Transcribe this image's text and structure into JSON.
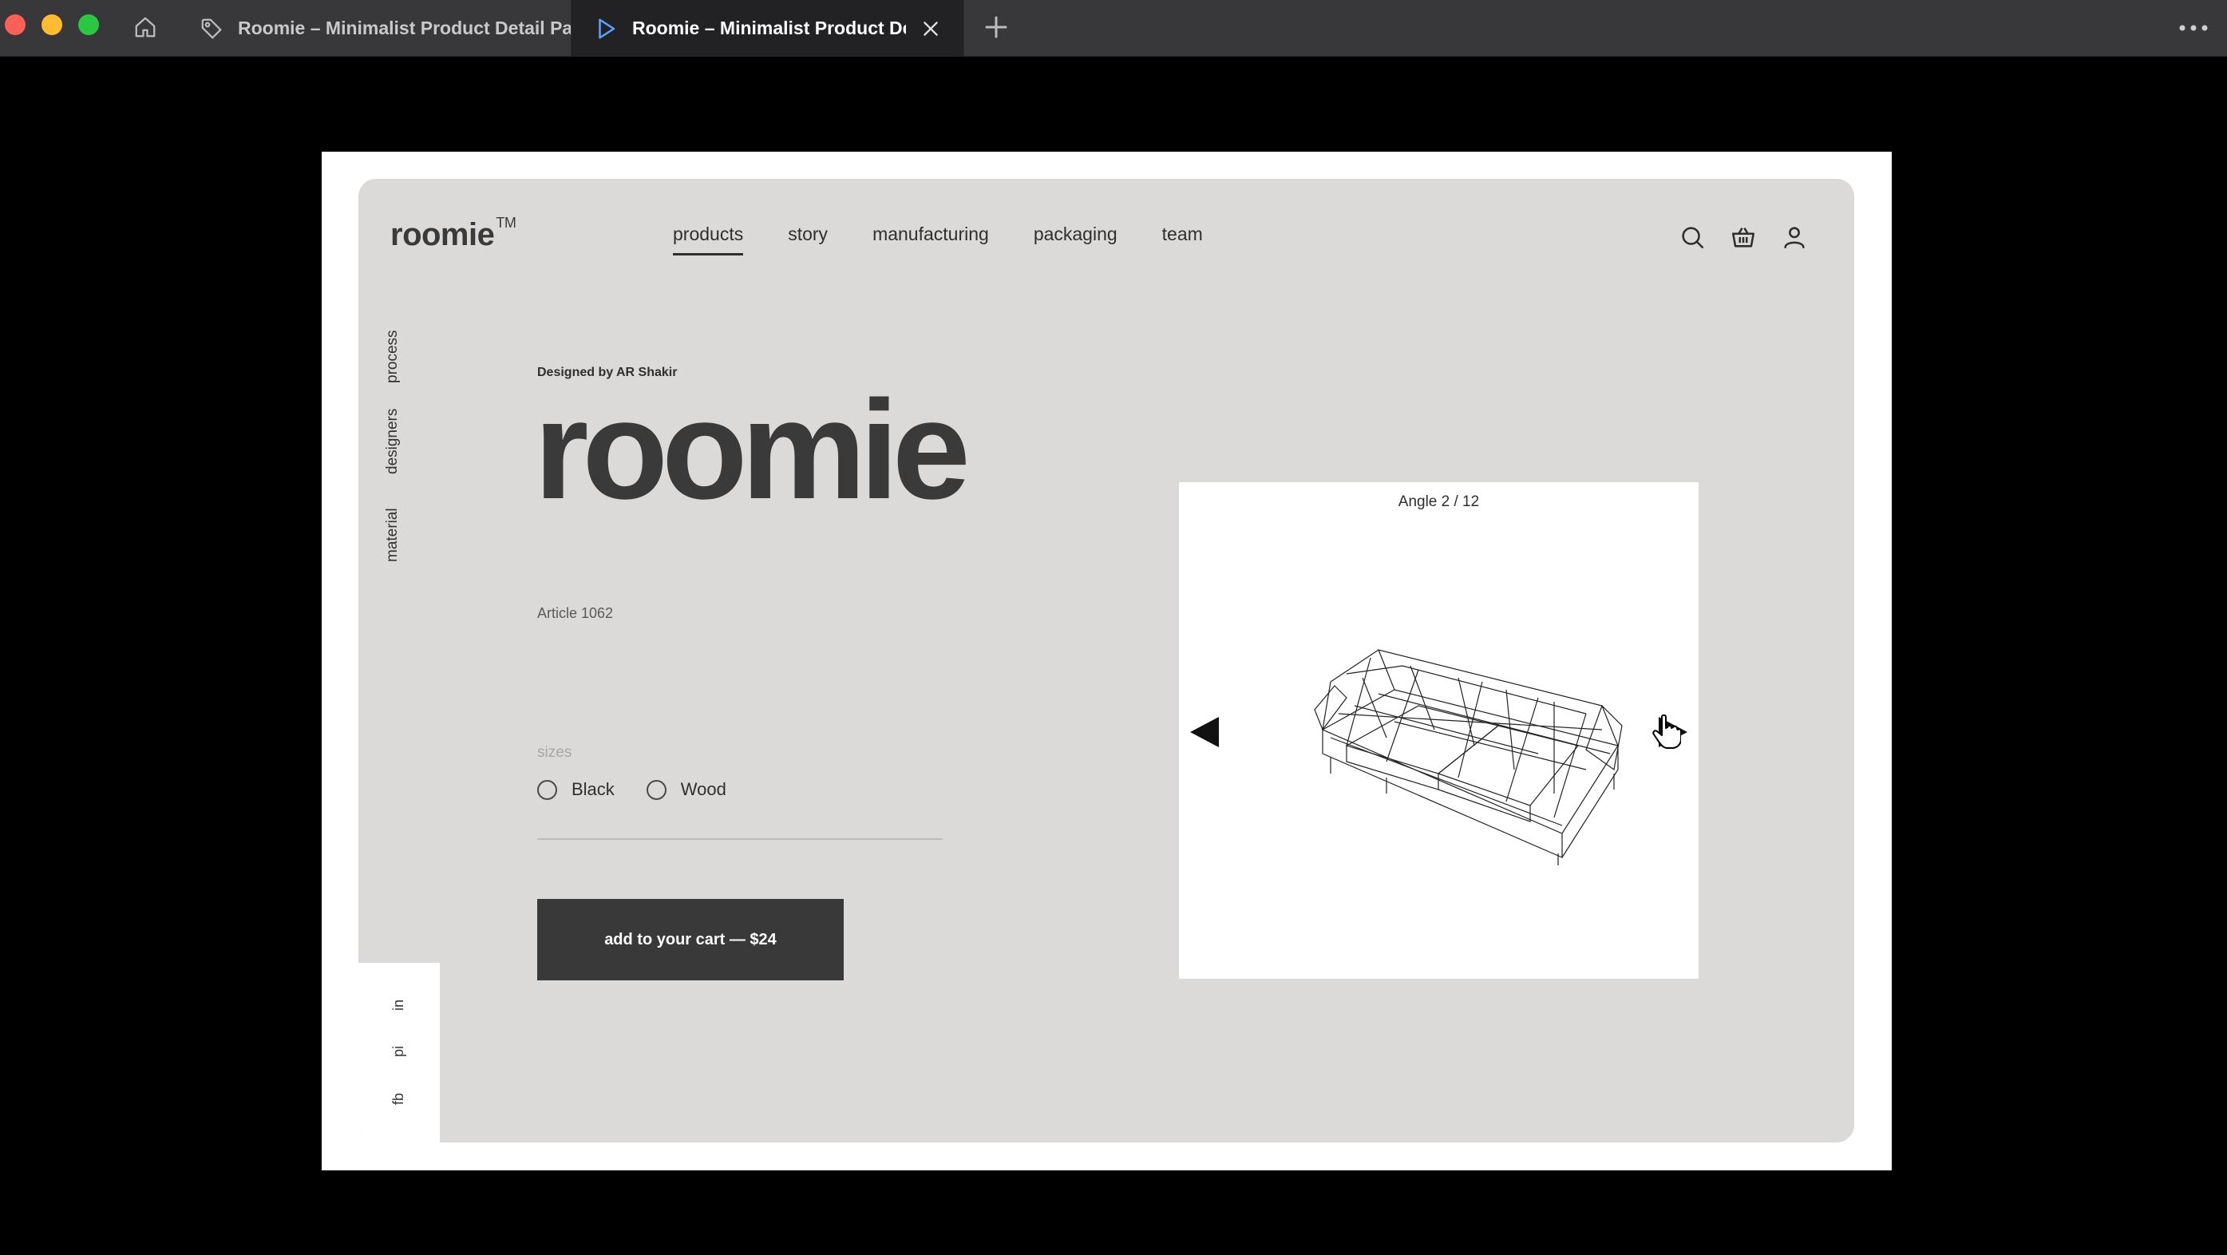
{
  "browser": {
    "tabs": [
      {
        "title": "Roomie – Minimalist Product Detail Page",
        "active": false
      },
      {
        "title": "Roomie – Minimalist Product Detail Page",
        "active": true
      }
    ]
  },
  "header": {
    "logo": "roomie",
    "logo_mark": "TM",
    "nav": [
      "products",
      "story",
      "manufacturing",
      "packaging",
      "team"
    ],
    "active_nav": "products"
  },
  "side_links": [
    "process",
    "designers",
    "material"
  ],
  "social_links": [
    "in",
    "pi",
    "fb"
  ],
  "product": {
    "designer": "Designed by AR Shakir",
    "name": "roomie",
    "article": "Article 1062",
    "sizes_label": "sizes",
    "options": [
      "Black",
      "Wood"
    ],
    "cart_label": "add to your cart — $24"
  },
  "viewer": {
    "angle": "Angle 2 / 12"
  },
  "colors": {
    "card_bg": "#dbdad8",
    "button_bg": "#393939",
    "chrome_bg": "#38383b"
  }
}
